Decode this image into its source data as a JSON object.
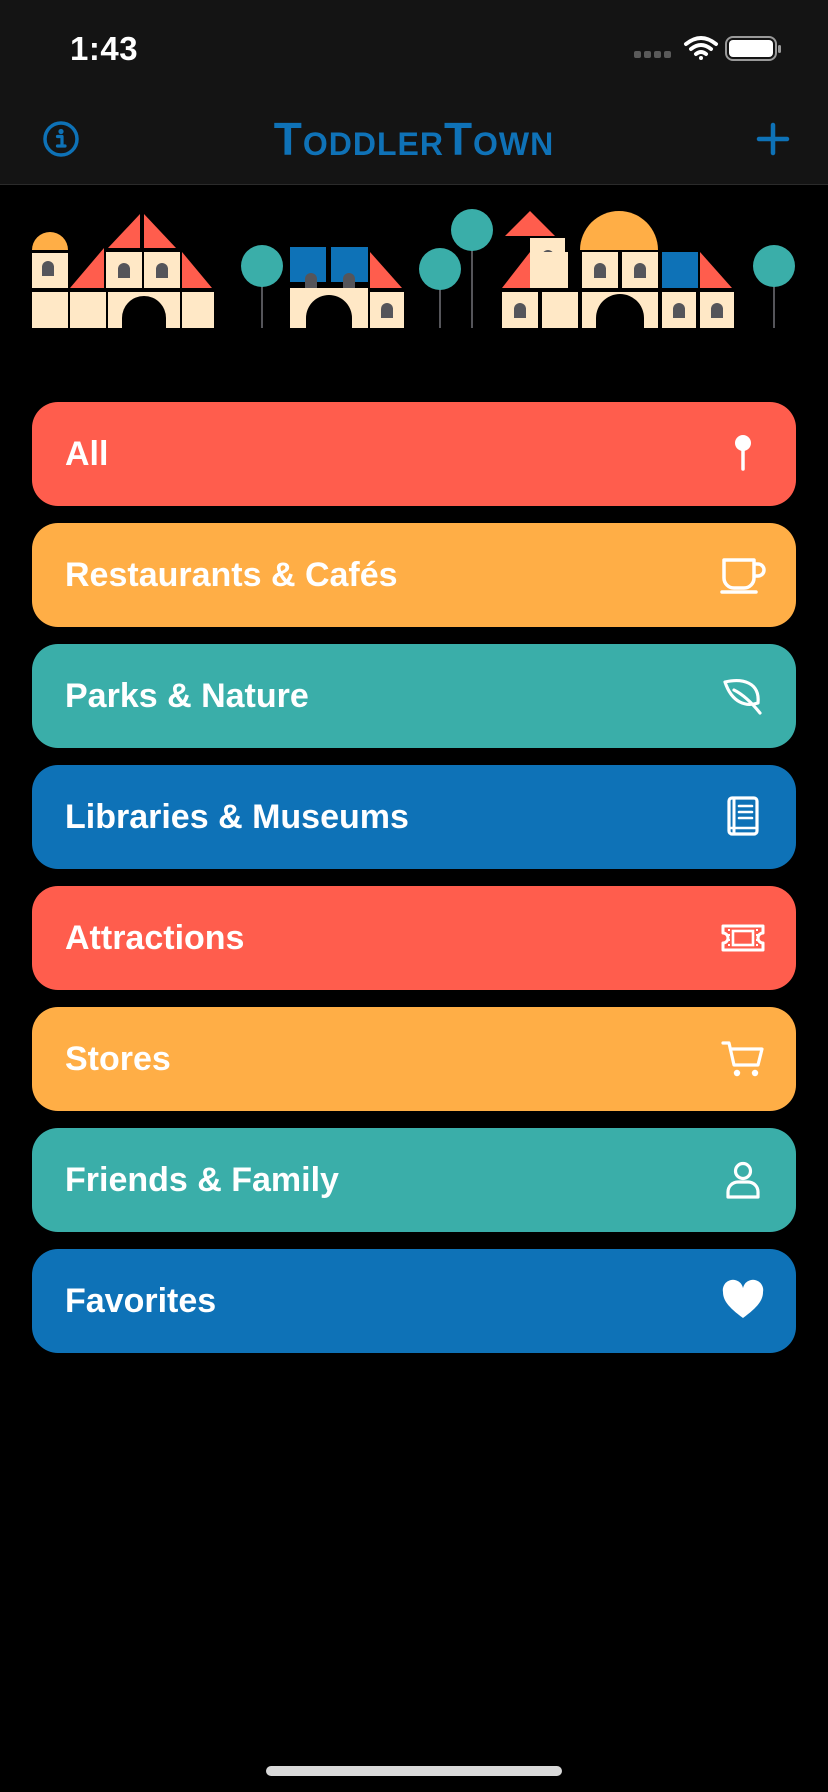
{
  "status_bar": {
    "time": "1:43"
  },
  "nav": {
    "title": "ToddlerTown"
  },
  "colors": {
    "red": "#ff5d4d",
    "orange": "#ffae46",
    "teal": "#3aaea9",
    "blue": "#0e72b7",
    "cream": "#ffe8c6",
    "window": "#55555a"
  },
  "categories": [
    {
      "label": "All",
      "color": "#ff5d4d",
      "icon": "map-pin-icon"
    },
    {
      "label": "Restaurants & Cafés",
      "color": "#ffae46",
      "icon": "coffee-cup-icon"
    },
    {
      "label": "Parks & Nature",
      "color": "#3aaea9",
      "icon": "leaf-icon"
    },
    {
      "label": "Libraries & Museums",
      "color": "#0e72b7",
      "icon": "book-icon"
    },
    {
      "label": "Attractions",
      "color": "#ff5d4d",
      "icon": "ticket-icon"
    },
    {
      "label": "Stores",
      "color": "#ffae46",
      "icon": "cart-icon"
    },
    {
      "label": "Friends & Family",
      "color": "#3aaea9",
      "icon": "person-icon"
    },
    {
      "label": "Favorites",
      "color": "#0e72b7",
      "icon": "heart-icon"
    }
  ]
}
